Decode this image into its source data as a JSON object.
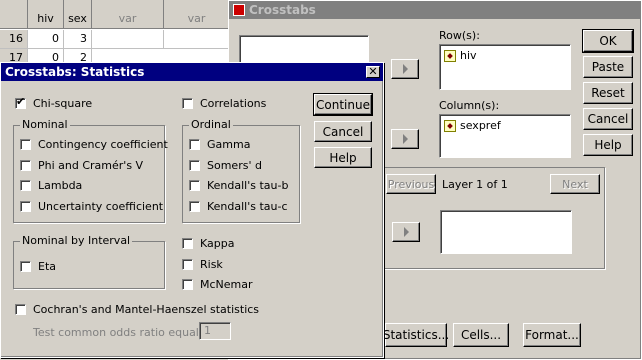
{
  "grid": {
    "columns": [
      "hiv",
      "sex",
      "var",
      "var"
    ],
    "rows": [
      {
        "num": "16",
        "hiv": "0",
        "sex": "3"
      },
      {
        "num": "17",
        "hiv": "0",
        "sex": "2"
      }
    ]
  },
  "crosstabs": {
    "title": "Crosstabs",
    "rows_label": "Row(s):",
    "rows_items": [
      "hiv"
    ],
    "columns_label": "Column(s):",
    "columns_items": [
      "sexpref"
    ],
    "buttons": {
      "ok": "OK",
      "paste": "Paste",
      "reset": "Reset",
      "cancel": "Cancel",
      "help": "Help"
    },
    "layer": {
      "previous": "Previous",
      "label": "Layer 1 of 1",
      "next": "Next"
    },
    "bottom_buttons": {
      "statistics": "Statistics...",
      "cells": "Cells...",
      "format": "Format..."
    },
    "partial_char": "s"
  },
  "statistics": {
    "title": "Crosstabs: Statistics",
    "close": "✕",
    "chi_square": {
      "label": "Chi-square",
      "checked": true
    },
    "correlations": {
      "label": "Correlations",
      "checked": false
    },
    "nominal": {
      "label": "Nominal",
      "items": [
        "Contingency coefficient",
        "Phi and Cramér's V",
        "Lambda",
        "Uncertainty coefficient"
      ]
    },
    "ordinal": {
      "label": "Ordinal",
      "items": [
        "Gamma",
        "Somers' d",
        "Kendall's tau-b",
        "Kendall's tau-c"
      ]
    },
    "nominal_by_interval": {
      "label": "Nominal by Interval",
      "items": [
        "Eta"
      ]
    },
    "other": [
      "Kappa",
      "Risk",
      "McNemar"
    ],
    "cmh": "Cochran's and Mantel-Haenszel statistics",
    "odds_label": "Test common odds ratio equals:",
    "odds_value": "1",
    "buttons": {
      "continue": "Continue",
      "cancel": "Cancel",
      "help": "Help"
    }
  }
}
